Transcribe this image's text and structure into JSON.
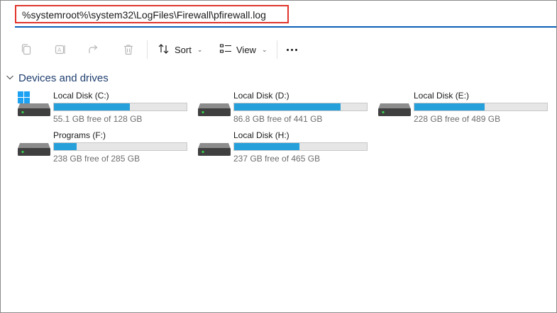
{
  "address_bar": {
    "path": "%systemroot%\\system32\\LogFiles\\Firewall\\pfirewall.log"
  },
  "toolbar": {
    "sort_label": "Sort",
    "view_label": "View",
    "icons": [
      "copy-icon",
      "rename-icon",
      "share-icon",
      "delete-icon",
      "sort-icon",
      "view-icon",
      "more-icon"
    ]
  },
  "section": {
    "title": "Devices and drives",
    "icon": "chevron-down-icon"
  },
  "drives": [
    {
      "name": "Local Disk (C:)",
      "free_text": "55.1 GB free of 128 GB",
      "used_fraction": 0.57,
      "windows": true
    },
    {
      "name": "Local Disk (D:)",
      "free_text": "86.8 GB free of 441 GB",
      "used_fraction": 0.8
    },
    {
      "name": "Local Disk (E:)",
      "free_text": "228 GB free of 489 GB",
      "used_fraction": 0.53
    },
    {
      "name": "Programs (F:)",
      "free_text": "238 GB free of 285 GB",
      "used_fraction": 0.17
    },
    {
      "name": "Local Disk (H:)",
      "free_text": "237 GB free of 465 GB",
      "used_fraction": 0.49
    }
  ],
  "colors": {
    "accent": "#0a5fb4",
    "highlight_border": "#e0342b",
    "usage_bar": "#26a0da",
    "section_title": "#1f3f6f"
  }
}
